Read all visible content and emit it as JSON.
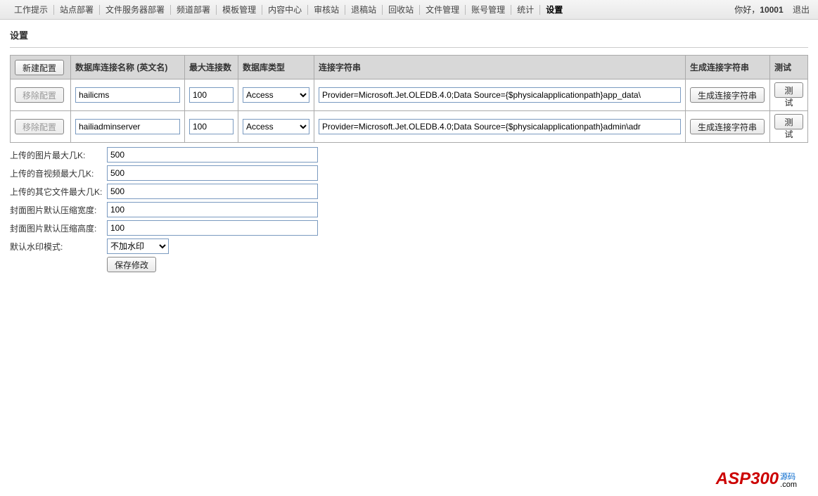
{
  "nav": {
    "items": [
      "工作提示",
      "站点部署",
      "文件服务器部署",
      "频道部署",
      "模板管理",
      "内容中心",
      "审核站",
      "退稿站",
      "回收站",
      "文件管理",
      "账号管理",
      "统计",
      "设置"
    ],
    "active_index": 12
  },
  "user": {
    "greeting": "你好，",
    "id": "10001",
    "logout": "退出"
  },
  "page_title": "设置",
  "table": {
    "new_config": "新建配置",
    "headers": {
      "name": "数据库连接名称 (英文名)",
      "max": "最大连接数",
      "type": "数据库类型",
      "conn": "连接字符串",
      "gen": "生成连接字符串",
      "test": "测试"
    },
    "remove_label": "移除配置",
    "gen_btn": "生成连接字符串",
    "test_btn": "测试",
    "rows": [
      {
        "name": "hailicms",
        "max": "100",
        "type": "Access",
        "conn": "Provider=Microsoft.Jet.OLEDB.4.0;Data Source={$physicalapplicationpath}app_data\\"
      },
      {
        "name": "hailiadminserver",
        "max": "100",
        "type": "Access",
        "conn": "Provider=Microsoft.Jet.OLEDB.4.0;Data Source={$physicalapplicationpath}admin\\adr"
      }
    ]
  },
  "form": {
    "rows": [
      {
        "label": "上传的图片最大几K:",
        "value": "500"
      },
      {
        "label": "上传的音视频最大几K:",
        "value": "500"
      },
      {
        "label": "上传的其它文件最大几K:",
        "value": "500"
      },
      {
        "label": "封面图片默认压缩宽度:",
        "value": "100"
      },
      {
        "label": "封面图片默认压缩高度:",
        "value": "100"
      }
    ],
    "watermark_label": "默认水印模式:",
    "watermark_value": "不加水印",
    "save": "保存修改"
  },
  "watermark_logo": {
    "main": "ASP300",
    "sub": "源码",
    "sub2": ".com"
  }
}
